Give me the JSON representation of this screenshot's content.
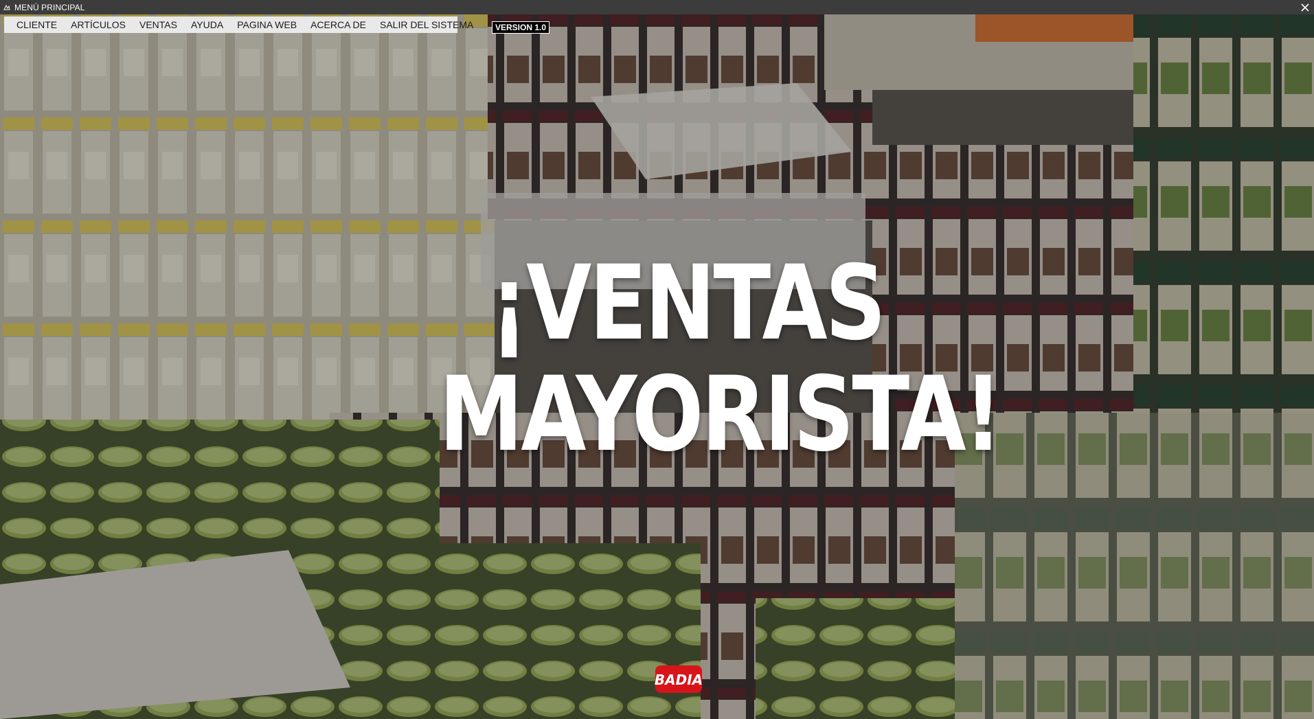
{
  "window": {
    "title": "MENÚ PRINCIPAL",
    "app_icon": "app-icon",
    "close_icon": "close-icon"
  },
  "menu": {
    "items": [
      {
        "label": "CLIENTE"
      },
      {
        "label": "ARTÍCULOS"
      },
      {
        "label": "VENTAS"
      },
      {
        "label": "AYUDA"
      },
      {
        "label": "PAGINA WEB"
      },
      {
        "label": "ACERCA DE"
      },
      {
        "label": "SALIR DEL SISTEMA"
      }
    ]
  },
  "version": "VERSION 1.0",
  "banner": {
    "line1": "¡VENTAS",
    "line2": "MAYORISTA!"
  },
  "logo": {
    "text": "BADIA",
    "color": "#d7141a"
  },
  "colors": {
    "titlebar": "#3c3c3c",
    "menubar": "#e9e9e9",
    "lid_green": "#7f9a3a",
    "lid_yellow": "#e3c23a",
    "lid_red": "#8a1e22"
  }
}
